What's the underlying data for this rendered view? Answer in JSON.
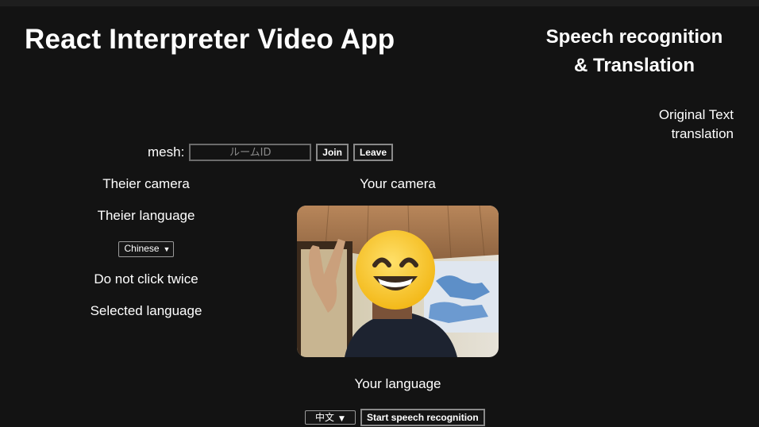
{
  "header": {
    "title": "React Interpreter Video App"
  },
  "speech_panel": {
    "title_line1": "Speech recognition",
    "title_line2": "& Translation",
    "original_text": "Original Text",
    "translation": "translation"
  },
  "mesh": {
    "label": "mesh:",
    "room_placeholder": "ルームID",
    "room_value": "",
    "join_label": "Join",
    "leave_label": "Leave"
  },
  "their_side": {
    "camera_label": "Theier camera",
    "language_label": "Theier language",
    "language_selected": "Chinese",
    "warning": "Do not click twice",
    "selected_language_label": "Selected language"
  },
  "your_side": {
    "camera_label": "Your camera",
    "language_label": "Your language",
    "language_selected": "中文",
    "start_button": "Start speech recognition"
  },
  "icons": {
    "dropdown": "chevron-down-icon",
    "video_overlay": "grinning-face-emoji"
  }
}
